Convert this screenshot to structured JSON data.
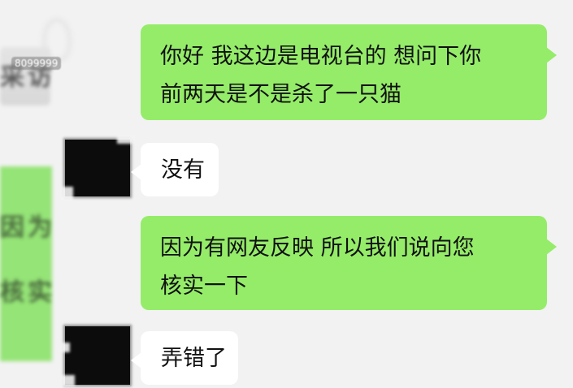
{
  "chat": {
    "messages": [
      {
        "sender": "outgoing",
        "line1": "你好 我这边是电视台的 想问下你",
        "line2": "前两天是不是杀了一只猫"
      },
      {
        "sender": "incoming",
        "text": "没有"
      },
      {
        "sender": "outgoing",
        "line1": "因为有网友反映 所以我们说向您",
        "line2": "核实一下"
      },
      {
        "sender": "incoming",
        "text": "弄错了"
      }
    ]
  },
  "watermark": {
    "id_text": "8099999",
    "ghost_text_top": "采访",
    "ghost_text_mid": "因为",
    "ghost_text_bottom": "核实"
  },
  "colors": {
    "outgoing_bubble": "#95ec69",
    "incoming_bubble": "#ffffff",
    "background": "#f2f2f2",
    "avatar_redaction": "#0c0c0c"
  }
}
